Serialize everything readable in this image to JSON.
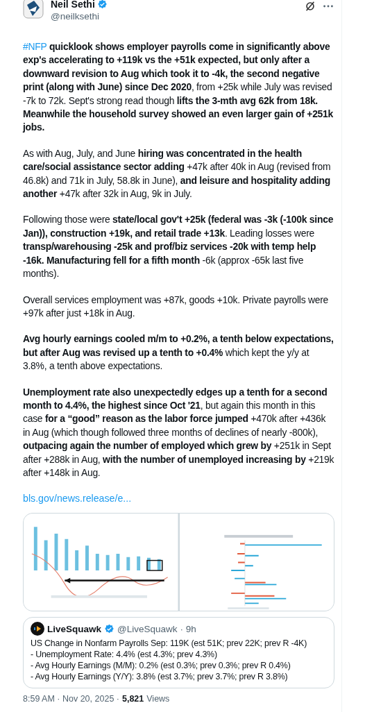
{
  "author": {
    "name": "Neil Sethi",
    "handle": "@neilksethi",
    "verified": true
  },
  "paragraphs": [
    {
      "hashtag": "#NFP",
      "text": " **quicklook shows employer payrolls come in significantly above exp's accelerating to +119k vs the +51k expected, but only after a downward revision to Aug which took it to -4k, the second negative print (along with June) since Dec 2020**, from +25k while July was revised -7k to 72k.  Sept's strong read though **lifts the 3-mth avg 62k from 18k.  Meanwhile the household survey showed an even larger gain of +251k jobs.**"
    },
    {
      "text": "As with Aug, July, and June **hiring was concentrated in the health care/social assistance sector adding** +47k after 40k in Aug (revised from 46.8k) and 71k in July, 58.8k in June), **and leisure and hospitality adding another** +47k after 32k in Aug, 9k in July."
    },
    {
      "text": "Following those were **state/local gov't +25k (federal was -3k (-100k since Jan)), construction +19k, and retail trade +13k**. Leading losses were **transp/warehousing -25k and prof/biz services -20k with temp help -16k. Manufacturing fell for a fifth month** -6k (approx -65k last five months)."
    },
    {
      "text": "Overall services employment was +87k, goods +10k. Private payrolls were +97k after just +18k in Aug."
    },
    {
      "text": "**Avg hourly earnings cooled m/m to +0.2%, a tenth below expectations, but after Aug was revised up a tenth to +0.4%** which kept the y/y at 3.8%, a tenth above expectations."
    },
    {
      "text": "**Unemployment rate also unexpectedly edges up a tenth for a second month to 4.4%, the highest since Oct '21**, but again this month in this case **for a “good” reason as the labor force jumped** +470k after +436k in Aug (which though followed three months of declines of nearly -800k), **outpacing again the number of employed which grew by** +251k in Sept after +288k in Aug, **with the number of unemployed increasing by** +219k after +148k in Aug."
    }
  ],
  "link": "bls.gov/news.release/e...",
  "quote": {
    "name": "LiveSquawk",
    "verified": true,
    "handle": "@LiveSquawk",
    "time": "· 9h",
    "lines": [
      "US Change in Nonfarm Payrolls Sep: 119K (est 51K; prev 22K; prev R -4K)",
      "- Unemployment Rate: 4.4% (est 4.3%; prev 4.3%)",
      "- Avg Hourly Earnings (M/M): 0.2% (est 0.3%; prev 0.3%; prev R 0.4%)",
      "- Avg Hourly Earnings (Y/Y): 3.8% (est 3.7%; prev 3.7%; prev R 3.8%)"
    ]
  },
  "footer": {
    "timestamp": "8:59 AM · Nov 20, 2025 ·",
    "views_count": "5,821",
    "views_label": "Views"
  }
}
